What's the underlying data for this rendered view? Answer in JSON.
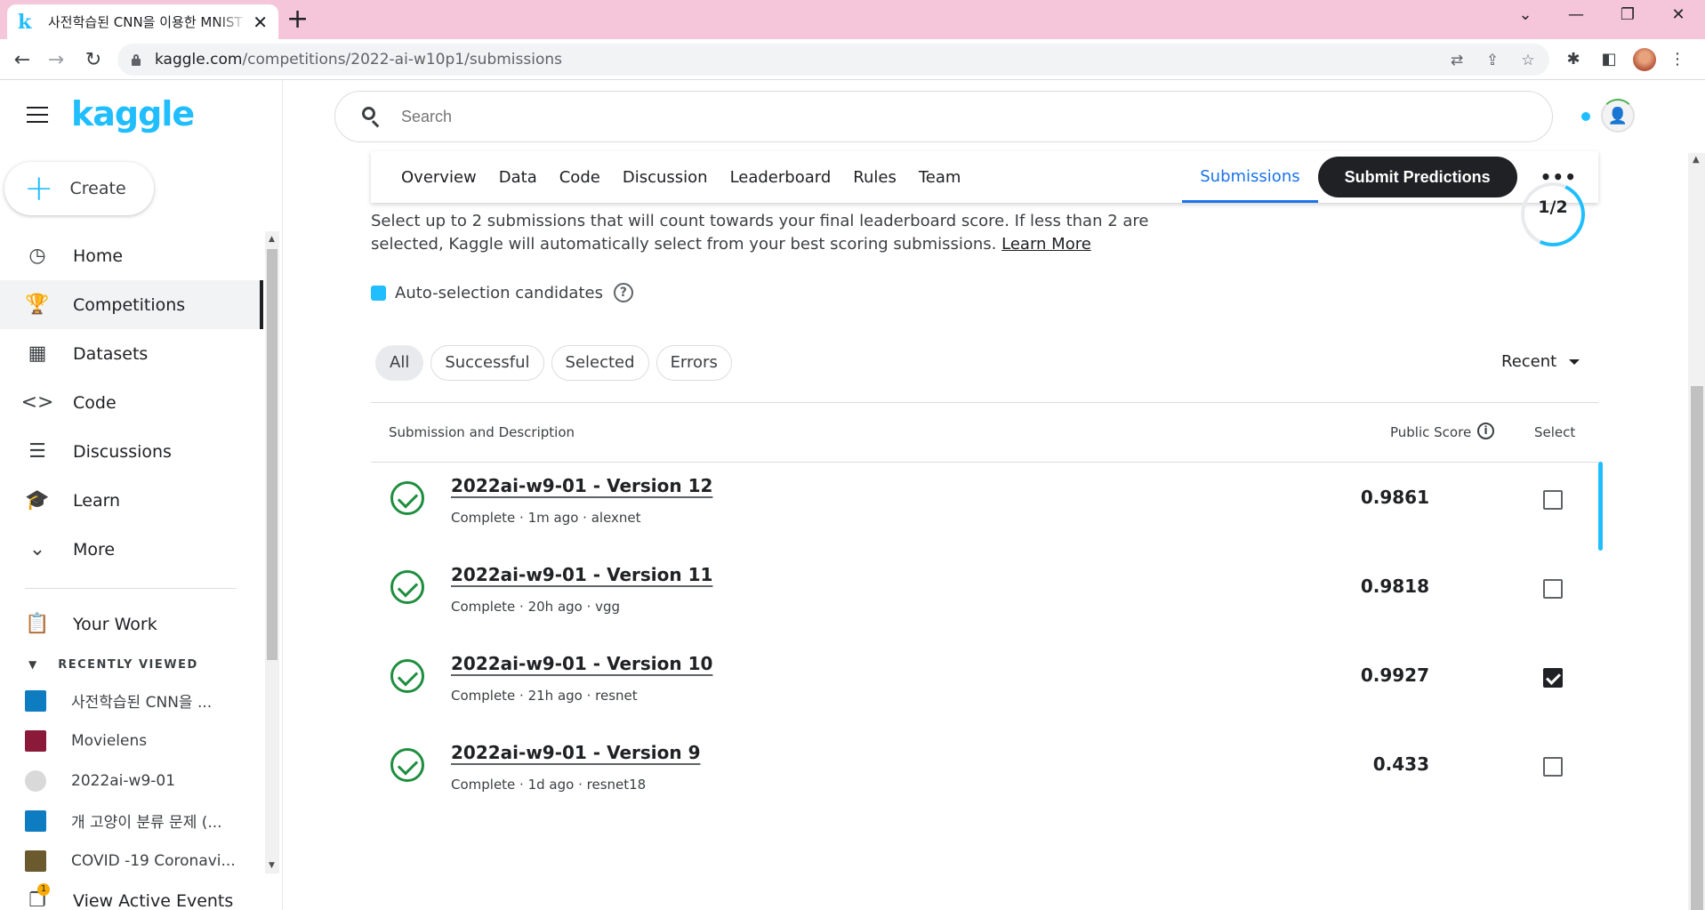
{
  "browser": {
    "tab_title": "사전학습된 CNN을 이용한 MNIST",
    "tab_close": "✕",
    "new_tab": "+",
    "url_host": "kaggle.com",
    "url_path": "/competitions/2022-ai-w10p1/submissions",
    "back": "←",
    "forward": "→",
    "reload": "↻",
    "win_down": "⌄",
    "win_min": "—",
    "win_restore": "❐",
    "win_close": "✕"
  },
  "sidebar": {
    "logo": "kaggle",
    "create_label": "Create",
    "nav": [
      {
        "label": "Home",
        "icon": "◷"
      },
      {
        "label": "Competitions",
        "icon": "🏆"
      },
      {
        "label": "Datasets",
        "icon": "▦"
      },
      {
        "label": "Code",
        "icon": "<>"
      },
      {
        "label": "Discussions",
        "icon": "☰"
      },
      {
        "label": "Learn",
        "icon": "🎓"
      },
      {
        "label": "More",
        "icon": "⌄"
      }
    ],
    "your_work": "Your Work",
    "recently_viewed_title": "RECENTLY VIEWED",
    "recently_viewed": [
      {
        "label": "사전학습된 CNN을 ...",
        "color": "#0e7cc1"
      },
      {
        "label": "Movielens",
        "color": "#8b1a3a"
      },
      {
        "label": "2022ai-w9-01",
        "color": "#d9d9d9"
      },
      {
        "label": "개 고양이 분류 문제 (...",
        "color": "#0e7cc1"
      },
      {
        "label": "COVID -19 Coronavi...",
        "color": "#6b5a2e"
      }
    ],
    "view_active_events": "View Active Events",
    "events_badge": "1"
  },
  "search": {
    "placeholder": "Search"
  },
  "competition_nav": {
    "tabs": [
      "Overview",
      "Data",
      "Code",
      "Discussion",
      "Leaderboard",
      "Rules",
      "Team"
    ],
    "submissions_tab": "Submissions",
    "submit_button": "Submit Predictions",
    "more": "•••"
  },
  "intro": {
    "text": "Select up to 2 submissions that will count towards your final leaderboard score. If less than 2 are selected, Kaggle will automatically select from your best scoring submissions.",
    "learn_more": "Learn More",
    "selected_count": "1/2"
  },
  "auto_selection": {
    "label": "Auto-selection candidates",
    "help": "?"
  },
  "filters": {
    "chips": [
      "All",
      "Successful",
      "Selected",
      "Errors"
    ],
    "sort": "Recent"
  },
  "table": {
    "col_submission": "Submission and Description",
    "col_score": "Public Score",
    "col_select": "Select",
    "info": "i",
    "rows": [
      {
        "title": "2022ai-w9-01 - Version 12",
        "meta": "Complete · 1m ago · alexnet",
        "score": "0.9861",
        "selected": false
      },
      {
        "title": "2022ai-w9-01 - Version 11",
        "meta": "Complete · 20h ago · vgg",
        "score": "0.9818",
        "selected": false
      },
      {
        "title": "2022ai-w9-01 - Version 10",
        "meta": "Complete · 21h ago · resnet",
        "score": "0.9927",
        "selected": true
      },
      {
        "title": "2022ai-w9-01 - Version 9",
        "meta": "Complete · 1d ago · resnet18",
        "score": "0.433",
        "selected": false
      }
    ]
  },
  "colors": {
    "kaggle_blue": "#20beff",
    "success_green": "#1e8e3e",
    "tab_blue": "#1a73e8"
  }
}
